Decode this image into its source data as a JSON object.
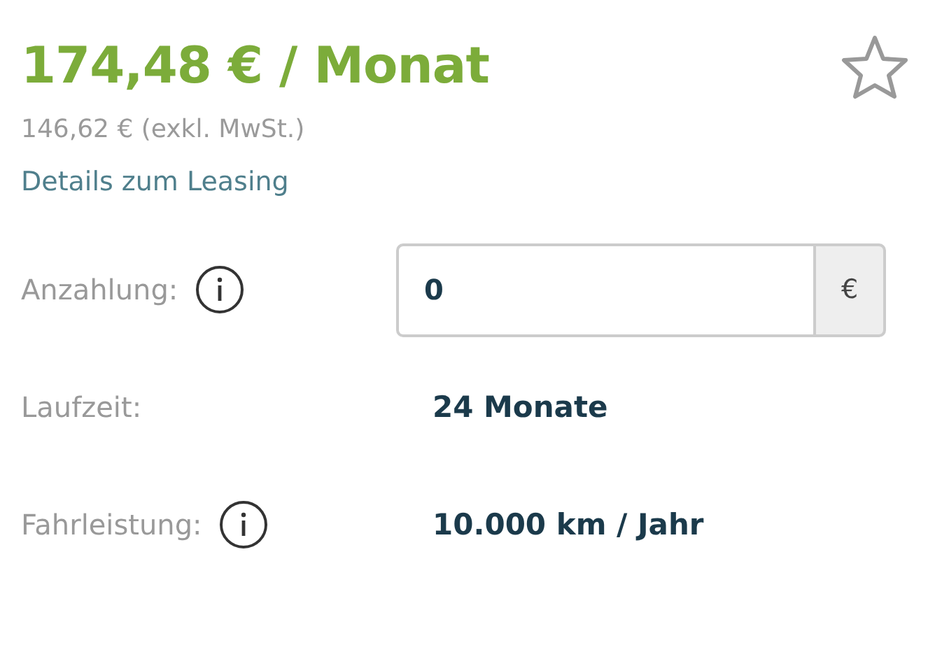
{
  "price": {
    "monthly": "174,48 € / Monat",
    "net": "146,62 € (exkl. MwSt.)",
    "details_link": "Details zum Leasing",
    "favorited": false
  },
  "fields": [
    {
      "kind": "input",
      "label": "Anzahlung:",
      "info": true,
      "value": "0",
      "unit": "€"
    },
    {
      "kind": "value",
      "label": "Laufzeit:",
      "info": false,
      "value": "24 Monate"
    },
    {
      "kind": "value",
      "label": "Fahrleistung:",
      "info": true,
      "value": "10.000 km / Jahr"
    }
  ]
}
